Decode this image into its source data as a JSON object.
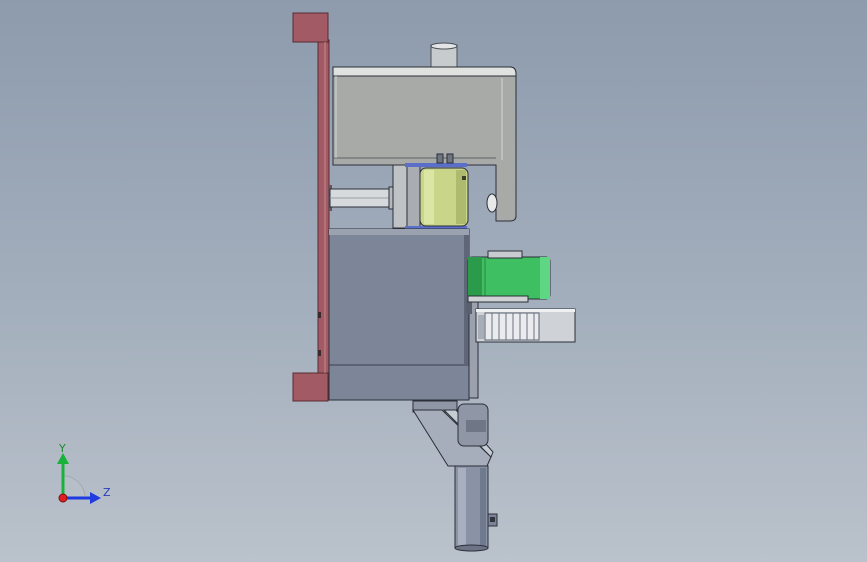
{
  "triad": {
    "y_label": "Y",
    "z_label": "Z",
    "colors": {
      "y": "#18b23a",
      "z": "#1f3be0",
      "x": "#e02020"
    }
  },
  "model": {
    "colors": {
      "plate": "#a25a64",
      "plate_edge": "#5a2a32",
      "housing": "#a7aaa7",
      "housing_top": "#d8dad8",
      "block": "#7d8698",
      "block_top": "#9aa2b0",
      "cylinder": "#c9d68a",
      "green_roller": "#3dbf62",
      "tube": "#8a93a6",
      "shaft": "#d2d6da",
      "outline": "#2b2f38"
    }
  }
}
